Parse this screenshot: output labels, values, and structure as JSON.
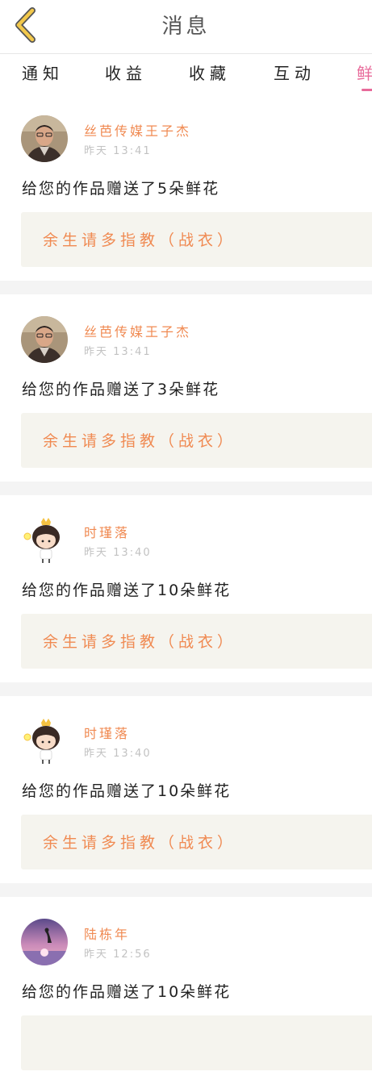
{
  "header": {
    "title": "消息",
    "back_icon": "chevron-left-icon",
    "back_color": "#f2c84b"
  },
  "tabs": [
    {
      "label": "通知"
    },
    {
      "label": "收益"
    },
    {
      "label": "收藏"
    },
    {
      "label": "互动"
    },
    {
      "label": "鲜",
      "active": true
    }
  ],
  "accent": "#e86a9a",
  "name_color": "#f08a52",
  "messages": [
    {
      "name": "丝芭传媒王子杰",
      "day": "昨天",
      "time": "13:41",
      "text": "给您的作品赠送了5朵鲜花",
      "work": "余生请多指教（战衣）",
      "avatar": "man-glasses-photo"
    },
    {
      "name": "丝芭传媒王子杰",
      "day": "昨天",
      "time": "13:41",
      "text": "给您的作品赠送了3朵鲜花",
      "work": "余生请多指教（战衣）",
      "avatar": "man-glasses-photo"
    },
    {
      "name": "时瑾落",
      "day": "昨天",
      "time": "13:40",
      "text": "给您的作品赠送了10朵鲜花",
      "work": "余生请多指教（战衣）",
      "avatar": "cartoon-girl-crown"
    },
    {
      "name": "时瑾落",
      "day": "昨天",
      "time": "13:40",
      "text": "给您的作品赠送了10朵鲜花",
      "work": "余生请多指教（战衣）",
      "avatar": "cartoon-girl-crown"
    },
    {
      "name": "陆栋年",
      "day": "昨天",
      "time": "12:56",
      "text": "给您的作品赠送了10朵鲜花",
      "work": "",
      "avatar": "sunset-sea-photo"
    }
  ]
}
